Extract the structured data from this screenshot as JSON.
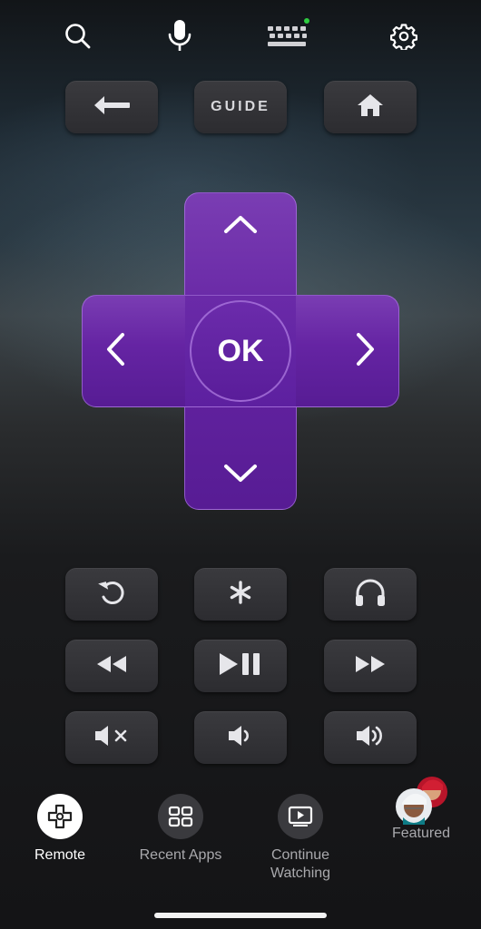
{
  "top_bar": {
    "search_icon": "search-icon",
    "voice_icon": "microphone-icon",
    "keyboard_icon": "keyboard-icon",
    "settings_icon": "gear-icon",
    "keyboard_status_color": "#2ecc40"
  },
  "nav_keys": {
    "back_icon": "back-arrow-icon",
    "guide_label": "GUIDE",
    "home_icon": "home-icon"
  },
  "dpad": {
    "ok_label": "OK",
    "accent_color": "#6a26a8"
  },
  "control_keys": [
    {
      "icon": "instant-replay-icon"
    },
    {
      "icon": "asterisk-icon"
    },
    {
      "icon": "headphones-icon"
    },
    {
      "icon": "rewind-icon"
    },
    {
      "icon": "play-pause-icon"
    },
    {
      "icon": "fast-forward-icon"
    },
    {
      "icon": "mute-icon"
    },
    {
      "icon": "volume-down-icon"
    },
    {
      "icon": "volume-up-icon"
    }
  ],
  "bottom_nav": {
    "items": [
      {
        "label": "Remote",
        "icon": "dpad-icon",
        "active": true
      },
      {
        "label": "Recent Apps",
        "icon": "grid-icon",
        "active": false
      },
      {
        "label": "Continue Watching",
        "icon": "play-box-icon",
        "active": false
      },
      {
        "label": "Featured",
        "icon": "featured-avatars-icon",
        "active": false
      }
    ]
  }
}
